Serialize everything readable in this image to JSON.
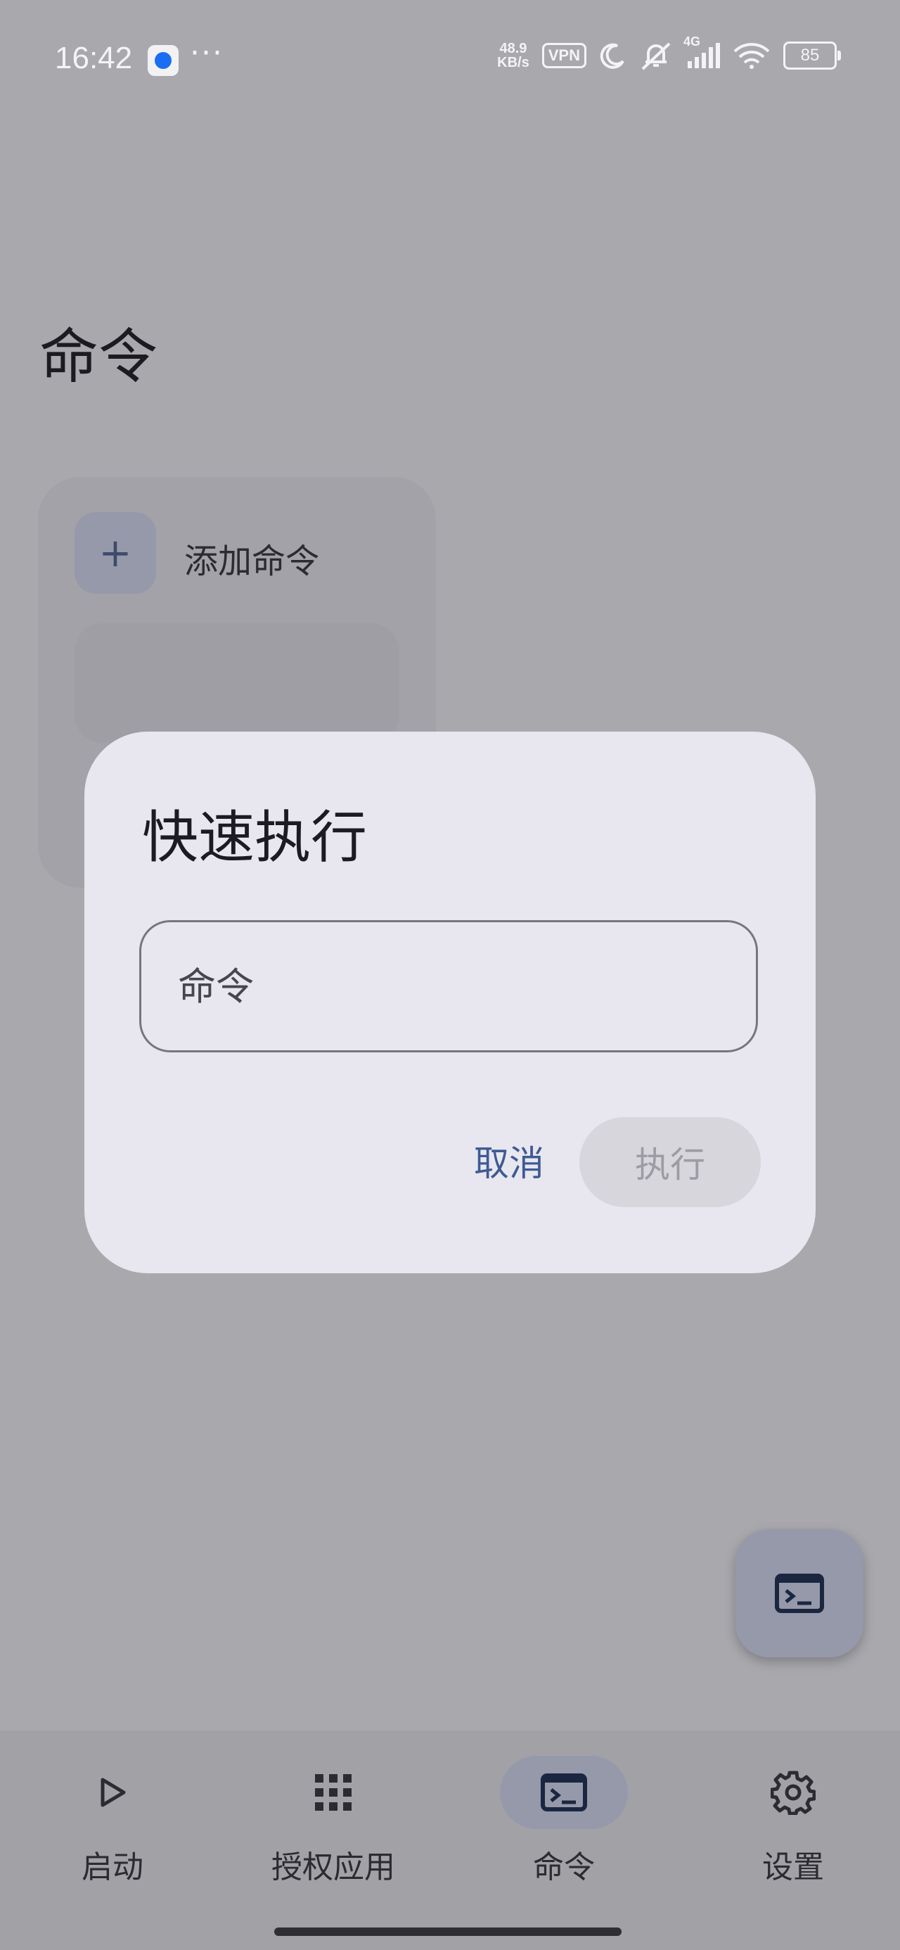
{
  "status_bar": {
    "time": "16:42",
    "net_speed_value": "48.9",
    "net_speed_unit": "KB/s",
    "vpn": "VPN",
    "network": "4G",
    "battery": "85"
  },
  "page": {
    "title": "命令"
  },
  "card": {
    "add_label": "添加命令"
  },
  "dialog": {
    "title": "快速执行",
    "input_placeholder": "命令",
    "cancel_label": "取消",
    "execute_label": "执行"
  },
  "nav": {
    "items": [
      {
        "label": "启动",
        "icon": "play-icon"
      },
      {
        "label": "授权应用",
        "icon": "grid-icon"
      },
      {
        "label": "命令",
        "icon": "terminal-icon",
        "active": true
      },
      {
        "label": "设置",
        "icon": "gear-icon"
      }
    ]
  },
  "colors": {
    "accent": "#3f5a93",
    "dialog_bg": "#e8e7ef",
    "scrim_bg": "#a9a8ad"
  }
}
